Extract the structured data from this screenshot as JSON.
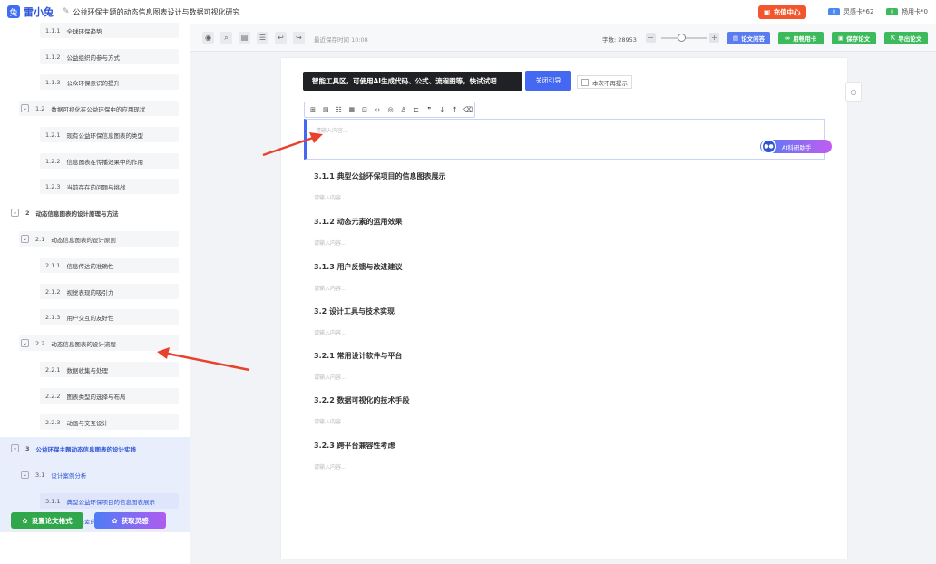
{
  "app": {
    "logo_text": "雷小兔",
    "doc_title": "公益环保主题的动态信息图表设计与数据可视化研究",
    "recharge": "充值中心",
    "card1": "灵感卡*62",
    "card2": "畅用卡*0"
  },
  "toolbar": {
    "save_time": "最近保存时间 10:08",
    "word_count": "字数: 28953",
    "btn_qa": "论文问答",
    "btn_card": "用畅用卡",
    "btn_save": "保存论文",
    "btn_export": "导出论文"
  },
  "toc": [
    {
      "num": "1.1.1",
      "label": "全球环保趋势"
    },
    {
      "num": "1.1.2",
      "label": "公益组织的参与方式"
    },
    {
      "num": "1.1.3",
      "label": "公众环保意识的提升"
    },
    {
      "num": "1.2",
      "label": "数据可视化在公益环保中的应用现状"
    },
    {
      "num": "1.2.1",
      "label": "现有公益环保信息图表的类型"
    },
    {
      "num": "1.2.2",
      "label": "信息图表在传播效果中的作用"
    },
    {
      "num": "1.2.3",
      "label": "当前存在的问题与挑战"
    },
    {
      "num": "2",
      "label": "动态信息图表的设计原理与方法"
    },
    {
      "num": "2.1",
      "label": "动态信息图表的设计原则"
    },
    {
      "num": "2.1.1",
      "label": "信息传达的准确性"
    },
    {
      "num": "2.1.2",
      "label": "视觉表现的吸引力"
    },
    {
      "num": "2.1.3",
      "label": "用户交互的友好性"
    },
    {
      "num": "2.2",
      "label": "动态信息图表的设计流程"
    },
    {
      "num": "2.2.1",
      "label": "数据收集与处理"
    },
    {
      "num": "2.2.2",
      "label": "图表类型的选择与布局"
    },
    {
      "num": "2.2.3",
      "label": "动画与交互设计"
    },
    {
      "num": "3",
      "label": "公益环保主题动态信息图表的设计实践"
    },
    {
      "num": "3.1",
      "label": "设计案例分析"
    },
    {
      "num": "3.1.1",
      "label": "典型公益环保项目的信息图表展示"
    },
    {
      "num": "3.1.2",
      "label": "动态元素的运用效果"
    }
  ],
  "sidebar_buttons": {
    "format": "设置论文格式",
    "inspire": "获取灵感"
  },
  "guide": {
    "tooltip": "智能工具区，可使用AI生成代码、公式、流程图等，快试试吧",
    "close": "关闭引导",
    "no_more": "本次不再提示"
  },
  "editor": {
    "placeholder": "请输入内容...",
    "ai_button": "AI科研助手"
  },
  "sections": [
    {
      "title": "3.1.1 典型公益环保项目的信息图表展示",
      "placeholder": "请输入内容..."
    },
    {
      "title": "3.1.2 动态元素的运用效果",
      "placeholder": "请输入内容..."
    },
    {
      "title": "3.1.3 用户反馈与改进建议",
      "placeholder": "请输入内容..."
    },
    {
      "title": "3.2 设计工具与技术实现",
      "placeholder": "请输入内容..."
    },
    {
      "title": "3.2.1 常用设计软件与平台",
      "placeholder": "请输入内容..."
    },
    {
      "title": "3.2.2 数据可视化的技术手段",
      "placeholder": "请输入内容..."
    },
    {
      "title": "3.2.3 跨平台兼容性考虑",
      "placeholder": "请输入内容..."
    }
  ],
  "colors": {
    "accent": "#4468f2",
    "recharge": "#f2562c",
    "green": "#2fa74a",
    "arrow": "#e8412c"
  }
}
